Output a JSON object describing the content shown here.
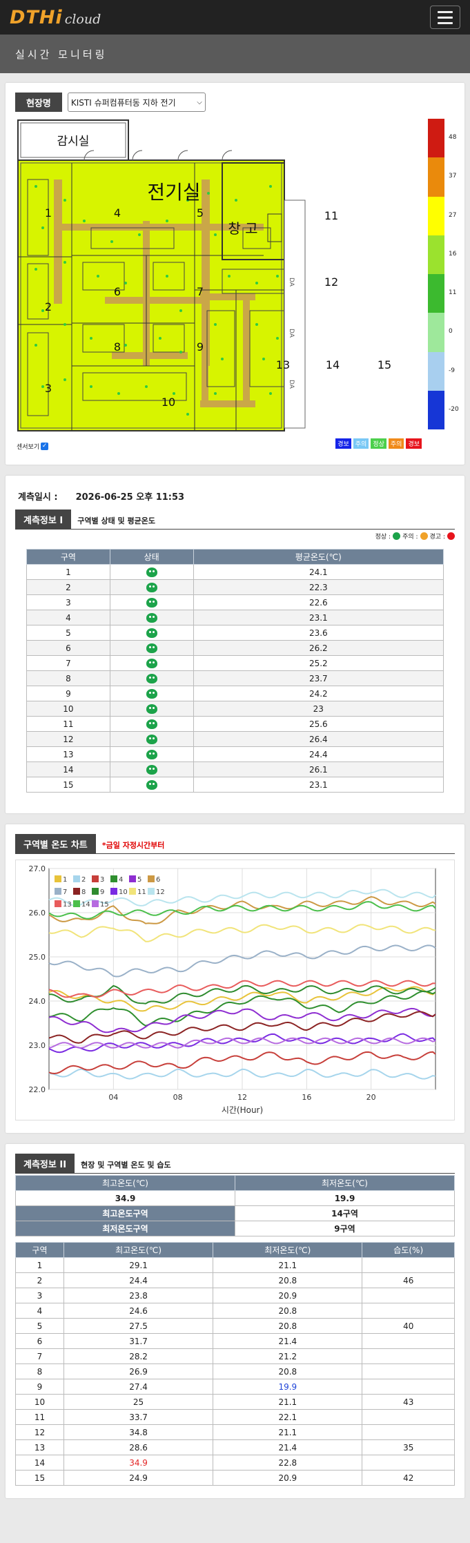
{
  "header": {
    "logo_main": "DTHi",
    "logo_sub": "cloud",
    "subtitle": "실시간 모니터링"
  },
  "site": {
    "label": "현장명",
    "selected": "KISTI 슈퍼컴퓨터동 지하 전기"
  },
  "floorplan": {
    "rooms": {
      "monitor": "감시실",
      "electric": "전기실",
      "storage": "창 고"
    },
    "zones": [
      "1",
      "2",
      "3",
      "4",
      "5",
      "6",
      "7",
      "8",
      "9",
      "10",
      "11",
      "12",
      "13",
      "14",
      "15"
    ],
    "door_label": "DA",
    "legend_ticks": [
      "48",
      "37",
      "27",
      "16",
      "11",
      "0",
      "-9",
      "-20"
    ],
    "legend_colors": [
      "#cf1b12",
      "#ea8a0c",
      "#ffff00",
      "#9be22e",
      "#3cba2f",
      "#9ee89b",
      "#a8cfef",
      "#1636d6"
    ],
    "status_keys": [
      {
        "label": "경보",
        "color": "#1524e8"
      },
      {
        "label": "주의",
        "color": "#79c8f5"
      },
      {
        "label": "정상",
        "color": "#4ccf4c"
      },
      {
        "label": "주의",
        "color": "#f08a1a"
      },
      {
        "label": "경보",
        "color": "#e7141c"
      }
    ],
    "sensor_toggle": "센서보기"
  },
  "measure": {
    "label": "계측일시 :",
    "value": "2026-06-25 오후 11:53"
  },
  "info1": {
    "title": "계측정보 I",
    "desc": "구역별 상태 및 평균온도",
    "legend": [
      "정상 :",
      "주의 :",
      "경고 :"
    ],
    "headers": [
      "구역",
      "상태",
      "평균온도(℃)"
    ],
    "rows": [
      {
        "zone": "1",
        "avg": "24.1"
      },
      {
        "zone": "2",
        "avg": "22.3"
      },
      {
        "zone": "3",
        "avg": "22.6"
      },
      {
        "zone": "4",
        "avg": "23.1"
      },
      {
        "zone": "5",
        "avg": "23.6"
      },
      {
        "zone": "6",
        "avg": "26.2"
      },
      {
        "zone": "7",
        "avg": "25.2"
      },
      {
        "zone": "8",
        "avg": "23.7"
      },
      {
        "zone": "9",
        "avg": "24.2"
      },
      {
        "zone": "10",
        "avg": "23"
      },
      {
        "zone": "11",
        "avg": "25.6"
      },
      {
        "zone": "12",
        "avg": "26.4"
      },
      {
        "zone": "13",
        "avg": "24.4"
      },
      {
        "zone": "14",
        "avg": "26.1"
      },
      {
        "zone": "15",
        "avg": "23.1"
      }
    ]
  },
  "chart_section": {
    "title": "구역별 온도 차트",
    "desc": "*금일 자정시간부터"
  },
  "chart_data": {
    "type": "line",
    "xlabel": "시간(Hour)",
    "ylabel": "",
    "xlim": [
      0,
      24
    ],
    "ylim": [
      22.0,
      27.0
    ],
    "xticks": [
      "04",
      "08",
      "12",
      "16",
      "20"
    ],
    "yticks": [
      "22.0",
      "23.0",
      "24.0",
      "25.0",
      "26.0",
      "27.0"
    ],
    "x": [
      0,
      2,
      4,
      6,
      8,
      10,
      12,
      14,
      16,
      18,
      20,
      22,
      24
    ],
    "series": [
      {
        "name": "1",
        "color": "#e8c33a",
        "values": [
          24.2,
          24.1,
          24.0,
          23.8,
          23.9,
          24.0,
          24.1,
          24.2,
          24.0,
          24.1,
          24.2,
          24.3,
          24.2
        ]
      },
      {
        "name": "2",
        "color": "#a6d5ec",
        "values": [
          22.3,
          22.4,
          22.3,
          22.3,
          22.4,
          22.3,
          22.4,
          22.3,
          22.4,
          22.3,
          22.4,
          22.3,
          22.3
        ]
      },
      {
        "name": "3",
        "color": "#c73f3a",
        "values": [
          22.4,
          22.5,
          22.5,
          22.6,
          22.5,
          22.7,
          22.7,
          22.8,
          22.6,
          22.7,
          22.8,
          22.7,
          22.8
        ]
      },
      {
        "name": "4",
        "color": "#2f8f2f",
        "values": [
          23.7,
          23.6,
          23.9,
          23.5,
          23.6,
          23.8,
          24.0,
          24.1,
          23.9,
          23.8,
          24.0,
          24.1,
          24.2
        ]
      },
      {
        "name": "5",
        "color": "#8e2ed1",
        "values": [
          23.6,
          23.5,
          23.3,
          23.4,
          23.6,
          23.7,
          23.8,
          23.6,
          23.7,
          23.6,
          23.7,
          23.8,
          23.7
        ]
      },
      {
        "name": "6",
        "color": "#cc9944",
        "values": [
          25.9,
          25.8,
          26.1,
          25.7,
          26.0,
          26.1,
          26.2,
          26.1,
          26.2,
          26.2,
          26.3,
          26.2,
          26.2
        ]
      },
      {
        "name": "7",
        "color": "#9ab1c8",
        "values": [
          24.9,
          24.8,
          24.6,
          24.7,
          24.7,
          24.9,
          25.0,
          25.1,
          25.0,
          25.1,
          25.2,
          25.2,
          25.2
        ]
      },
      {
        "name": "8",
        "color": "#8b2323",
        "values": [
          23.2,
          23.1,
          23.3,
          23.2,
          23.3,
          23.4,
          23.4,
          23.5,
          23.4,
          23.5,
          23.6,
          23.7,
          23.7
        ]
      },
      {
        "name": "9",
        "color": "#2e8b2e",
        "values": [
          24.1,
          24.0,
          24.3,
          23.9,
          24.1,
          24.2,
          24.3,
          24.2,
          24.3,
          24.2,
          24.3,
          24.2,
          24.3
        ]
      },
      {
        "name": "10",
        "color": "#7a2be2",
        "values": [
          22.9,
          22.9,
          23.0,
          23.0,
          23.0,
          23.1,
          23.1,
          23.2,
          23.1,
          23.1,
          23.1,
          23.2,
          23.1
        ]
      },
      {
        "name": "11",
        "color": "#f1e47a",
        "values": [
          25.6,
          25.5,
          25.7,
          25.4,
          25.5,
          25.6,
          25.6,
          25.7,
          25.6,
          25.6,
          25.7,
          25.6,
          25.6
        ]
      },
      {
        "name": "12",
        "color": "#b9e4ee",
        "values": [
          26.3,
          26.2,
          26.3,
          26.2,
          26.3,
          26.3,
          26.4,
          26.4,
          26.4,
          26.4,
          26.5,
          26.4,
          26.4
        ]
      },
      {
        "name": "13",
        "color": "#e85c5c",
        "values": [
          24.2,
          24.1,
          24.2,
          24.2,
          24.3,
          24.3,
          24.4,
          24.4,
          24.4,
          24.4,
          24.4,
          24.4,
          24.4
        ]
      },
      {
        "name": "14",
        "color": "#4bbf4b",
        "values": [
          26.0,
          25.9,
          26.0,
          26.0,
          26.0,
          26.1,
          26.1,
          26.1,
          26.1,
          26.1,
          26.2,
          26.1,
          26.1
        ]
      },
      {
        "name": "15",
        "color": "#b66be0",
        "values": [
          23.0,
          23.0,
          23.0,
          23.0,
          23.0,
          23.1,
          23.1,
          23.1,
          23.1,
          23.1,
          23.1,
          23.1,
          23.1
        ]
      }
    ]
  },
  "info2": {
    "title": "계측정보 II",
    "desc": "현장 및 구역별 온도 및 습도",
    "summary": {
      "max_header": "최고온도(℃)",
      "min_header": "최저온도(℃)",
      "max_value": "34.9",
      "min_value": "19.9",
      "max_zone_label": "최고온도구역",
      "max_zone_value": "14구역",
      "min_zone_label": "최저온도구역",
      "min_zone_value": "9구역"
    },
    "headers": [
      "구역",
      "최고온도(℃)",
      "최저온도(℃)",
      "습도(%)"
    ],
    "rows": [
      {
        "zone": "1",
        "max": "29.1",
        "min": "21.1",
        "hum": ""
      },
      {
        "zone": "2",
        "max": "24.4",
        "min": "20.8",
        "hum": "46"
      },
      {
        "zone": "3",
        "max": "23.8",
        "min": "20.9",
        "hum": ""
      },
      {
        "zone": "4",
        "max": "24.6",
        "min": "20.8",
        "hum": ""
      },
      {
        "zone": "5",
        "max": "27.5",
        "min": "20.8",
        "hum": "40"
      },
      {
        "zone": "6",
        "max": "31.7",
        "min": "21.4",
        "hum": ""
      },
      {
        "zone": "7",
        "max": "28.2",
        "min": "21.2",
        "hum": ""
      },
      {
        "zone": "8",
        "max": "26.9",
        "min": "20.8",
        "hum": ""
      },
      {
        "zone": "9",
        "max": "27.4",
        "min": "19.9",
        "hum": "",
        "min_color": "blue"
      },
      {
        "zone": "10",
        "max": "25",
        "min": "21.1",
        "hum": "43"
      },
      {
        "zone": "11",
        "max": "33.7",
        "min": "22.1",
        "hum": ""
      },
      {
        "zone": "12",
        "max": "34.8",
        "min": "21.1",
        "hum": ""
      },
      {
        "zone": "13",
        "max": "28.6",
        "min": "21.4",
        "hum": "35"
      },
      {
        "zone": "14",
        "max": "34.9",
        "min": "22.8",
        "hum": "",
        "max_color": "red"
      },
      {
        "zone": "15",
        "max": "24.9",
        "min": "20.9",
        "hum": "42"
      }
    ]
  }
}
